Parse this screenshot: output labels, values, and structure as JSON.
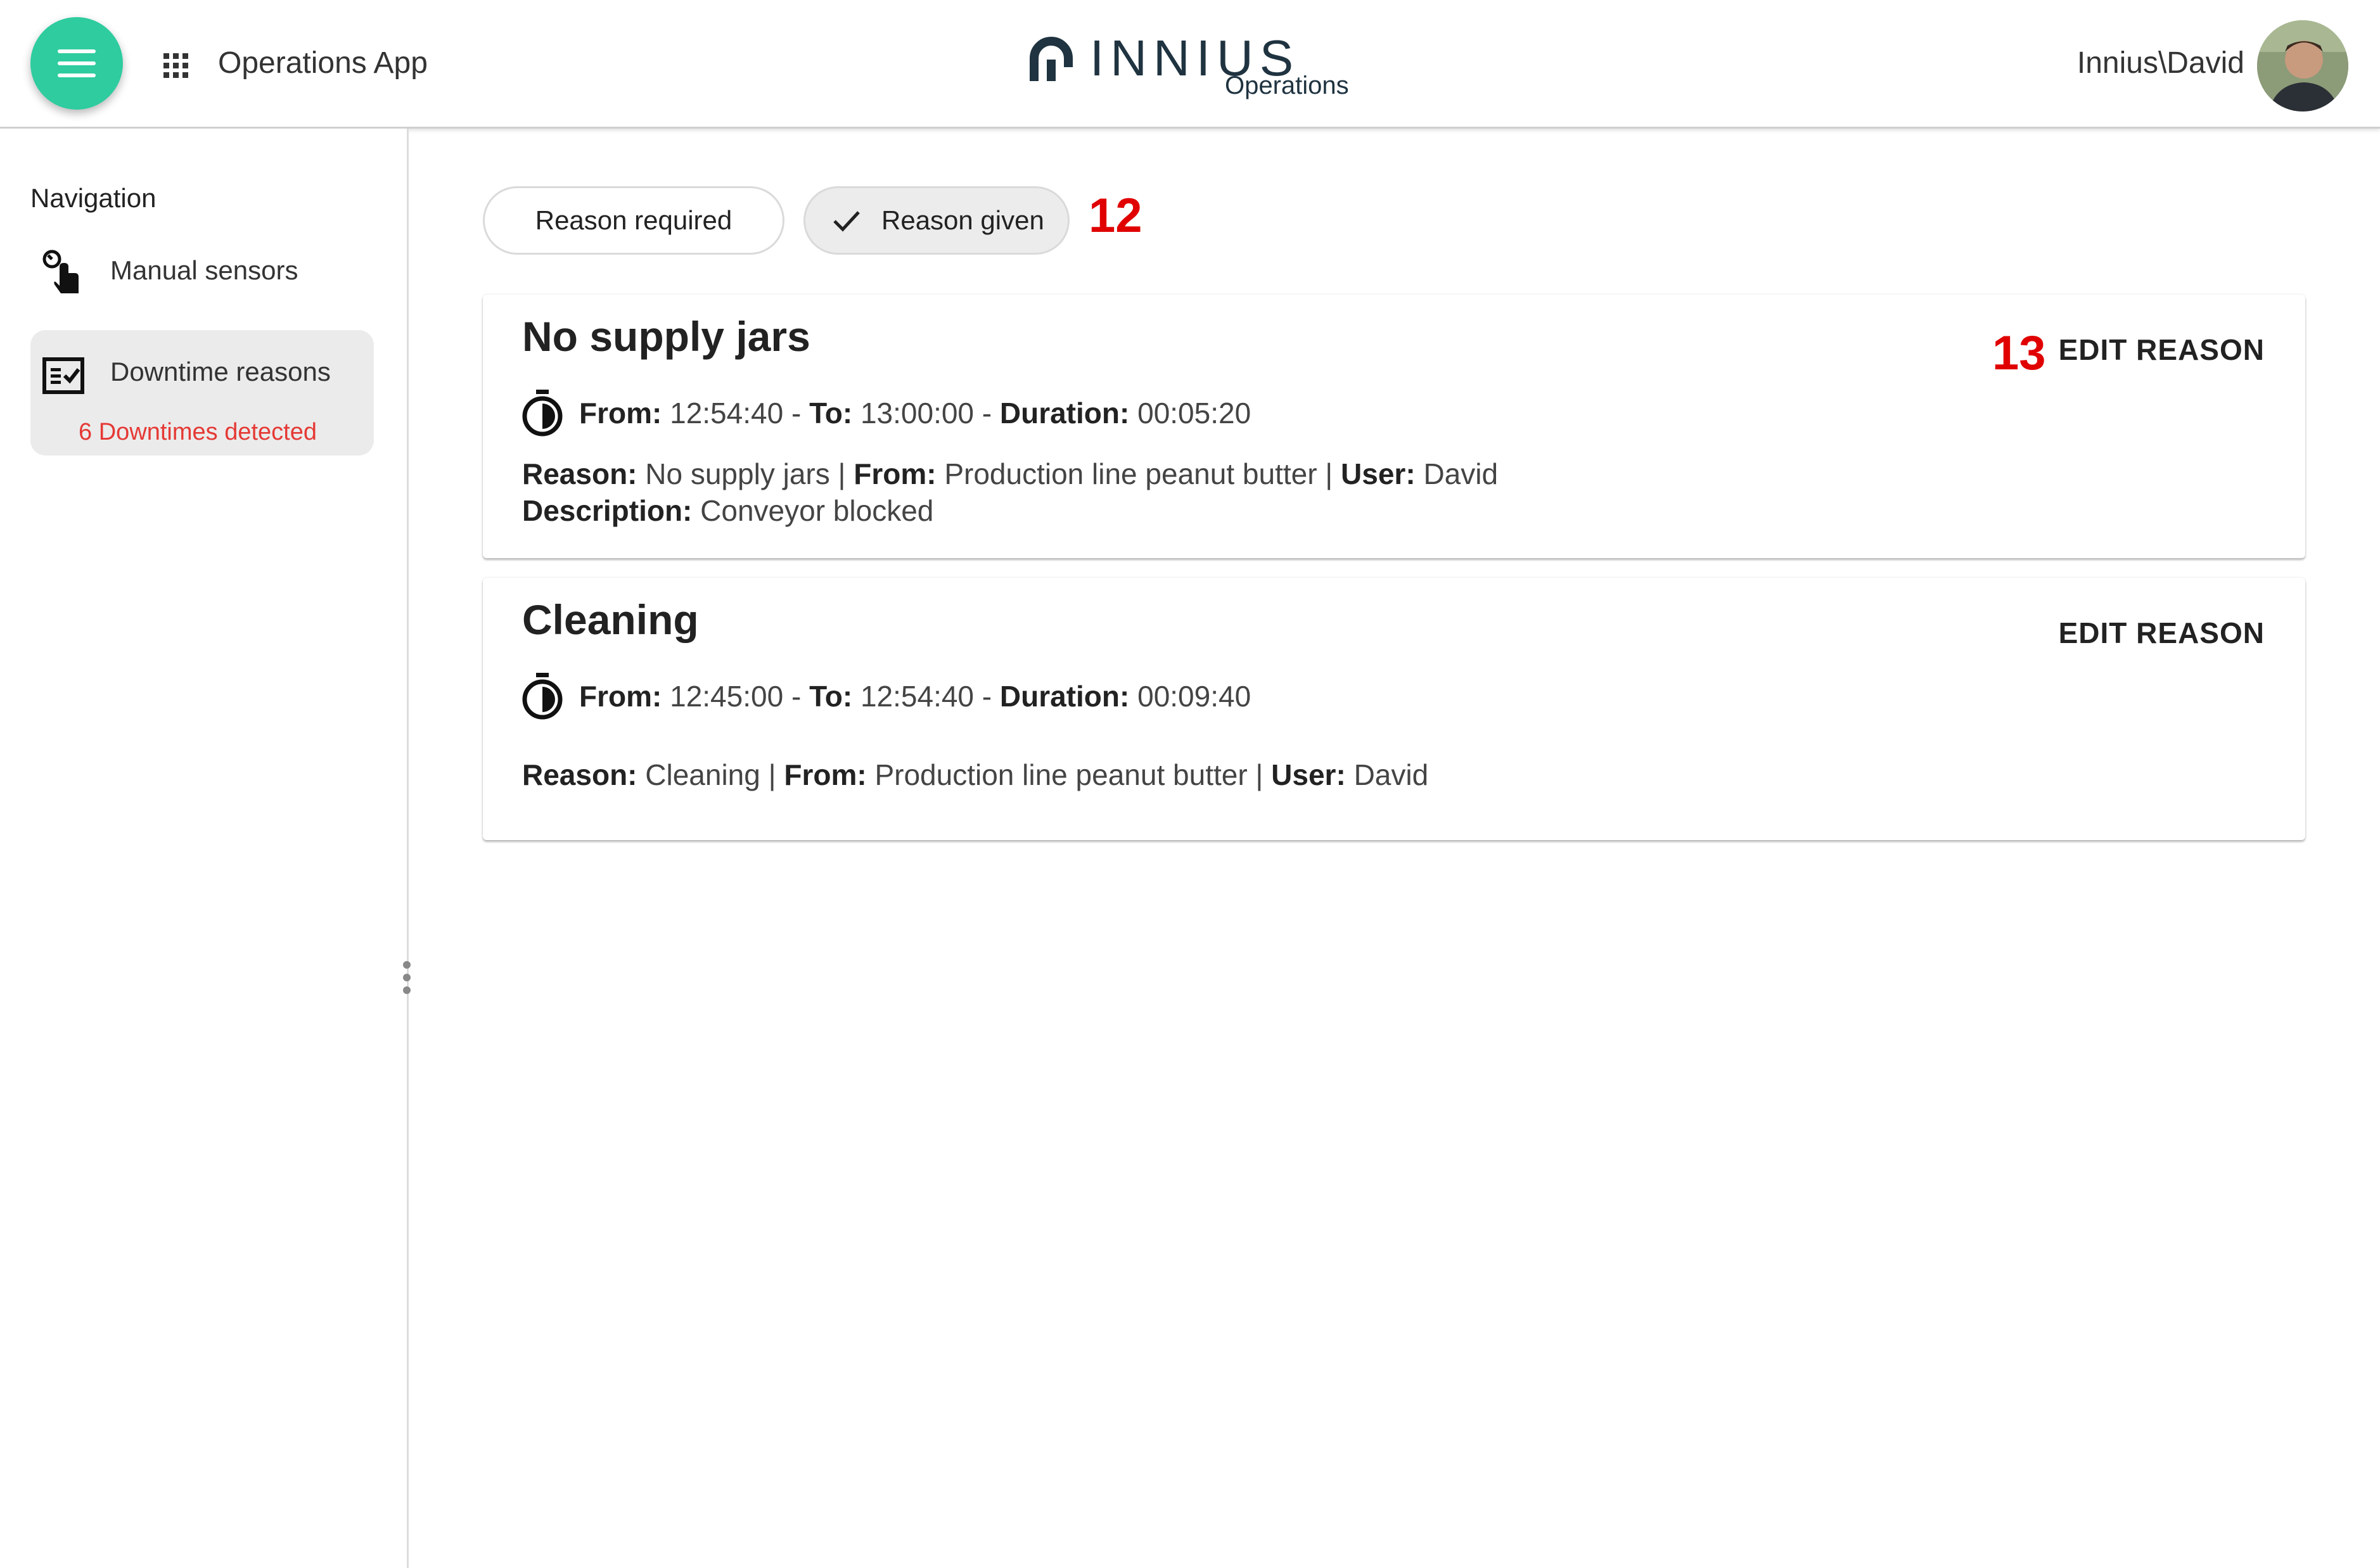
{
  "header": {
    "app_title": "Operations App",
    "logo_text": "INNIUS",
    "logo_sub": "Operations",
    "user": "Innius\\David",
    "brand_color": "#2ecc9f"
  },
  "sidebar": {
    "title": "Navigation",
    "items": [
      {
        "label": "Manual sensors",
        "icon": "touch-sensor-icon"
      },
      {
        "label": "Downtime reasons",
        "icon": "checklist-icon",
        "sub": "6 Downtimes detected",
        "selected": true
      }
    ]
  },
  "filters": {
    "required_label": "Reason required",
    "given_label": "Reason given",
    "given_selected": true
  },
  "annotations": {
    "a12": "12",
    "a13": "13"
  },
  "labels": {
    "from": "From:",
    "to": "To:",
    "duration": "Duration:",
    "reason": "Reason:",
    "user": "User:",
    "description": "Description:",
    "sep_dash": " - ",
    "sep_bar": " | "
  },
  "cards": [
    {
      "title": "No supply jars",
      "edit_label": "EDIT REASON",
      "from": "12:54:40",
      "to": "13:00:00",
      "duration": "00:05:20",
      "reason": "No supply jars",
      "source": "Production line peanut butter",
      "user": "David",
      "description": "Conveyor blocked"
    },
    {
      "title": "Cleaning",
      "edit_label": "EDIT REASON",
      "from": "12:45:00",
      "to": "12:54:40",
      "duration": "00:09:40",
      "reason": "Cleaning",
      "source": "Production line peanut butter",
      "user": "David"
    }
  ]
}
